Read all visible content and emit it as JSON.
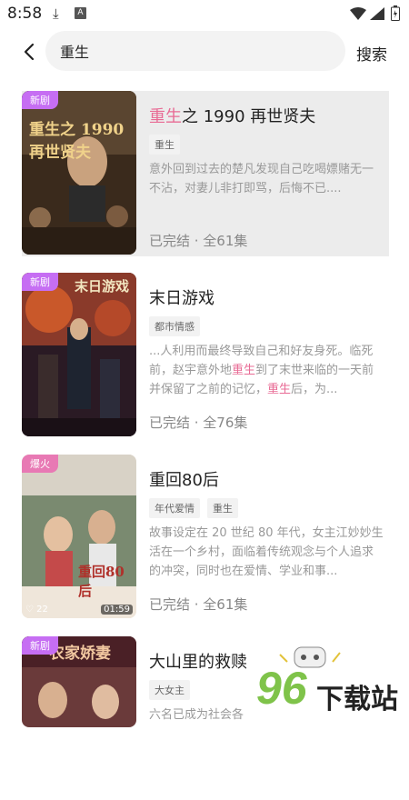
{
  "status": {
    "time": "8:58",
    "app_icon_letter": "A"
  },
  "search": {
    "query": "重生",
    "button_label": "搜索"
  },
  "results": [
    {
      "badge": "新剧",
      "poster_title": "重生之 1990 再世贤夫",
      "title_highlight": "重生",
      "title_rest": "之 1990 再世贤夫",
      "tags": [
        "重生"
      ],
      "desc": "意外回到过去的楚凡发现自己吃喝嫖赌无一不沾，对妻儿非打即骂，后悔不已....",
      "status": "已完结 · 全61集"
    },
    {
      "badge": "新剧",
      "poster_title": "末日游戏",
      "title": "末日游戏",
      "tags": [
        "都市情感"
      ],
      "desc_parts": [
        "...人利用而最终导致自己和好友身死。临死前，赵宇意外地",
        "重生",
        "到了末世来临的一天前并保留了之前的记忆，",
        "重生",
        "后，为..."
      ],
      "status": "已完结 · 全76集"
    },
    {
      "badge": "爆火",
      "poster_title": "重回80后",
      "title": "重回80后",
      "tags": [
        "年代爱情",
        "重生"
      ],
      "desc": "故事设定在 20 世纪 80 年代，女主江妙妙生活在一个乡村，面临着传统观念与个人追求的冲突，同时也在爱情、学业和事...",
      "likes": "22",
      "duration": "01:59",
      "status": "已完结 · 全61集"
    },
    {
      "badge": "新剧",
      "poster_title": "农家娇妻",
      "title": "大山里的救赎",
      "tags": [
        "大女主"
      ],
      "desc": "六名已成为社会各"
    }
  ],
  "watermark": {
    "text": "下载站",
    "digits": "96"
  },
  "colors": {
    "highlight": "#e86b95",
    "badge_new": "#c66ef3",
    "badge_fire": "#e879b4"
  }
}
